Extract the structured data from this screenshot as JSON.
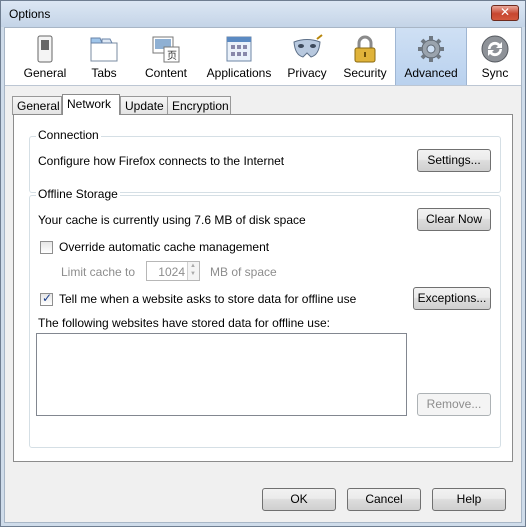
{
  "window": {
    "title": "Options",
    "close_glyph": "✕"
  },
  "panes": [
    {
      "id": "general",
      "label": "General",
      "icon": "switch-icon"
    },
    {
      "id": "tabs",
      "label": "Tabs",
      "icon": "tabs-icon"
    },
    {
      "id": "content",
      "label": "Content",
      "icon": "content-icon"
    },
    {
      "id": "applications",
      "label": "Applications",
      "icon": "applications-icon"
    },
    {
      "id": "privacy",
      "label": "Privacy",
      "icon": "mask-icon"
    },
    {
      "id": "security",
      "label": "Security",
      "icon": "padlock-icon"
    },
    {
      "id": "advanced",
      "label": "Advanced",
      "icon": "gear-icon",
      "selected": true
    },
    {
      "id": "sync",
      "label": "Sync",
      "icon": "sync-icon"
    }
  ],
  "subtabs": [
    {
      "label": "General"
    },
    {
      "label": "Network",
      "selected": true
    },
    {
      "label": "Update"
    },
    {
      "label": "Encryption"
    }
  ],
  "connection": {
    "title": "Connection",
    "description": "Configure how Firefox connects to the Internet",
    "settings_label": "Settings..."
  },
  "offline": {
    "title": "Offline Storage",
    "cache_text": "Your cache is currently using 7.6 MB of disk space",
    "clear_now_label": "Clear Now",
    "override_label": "Override automatic cache management",
    "override_checked": false,
    "limit_label": "Limit cache to",
    "limit_value": "1024",
    "limit_unit": "MB of space",
    "tell_me_label": "Tell me when a website asks to store data for offline use",
    "tell_me_checked": true,
    "exceptions_label": "Exceptions...",
    "stored_label": "The following websites have stored data for offline use:",
    "remove_label": "Remove..."
  },
  "footer": {
    "ok_label": "OK",
    "cancel_label": "Cancel",
    "help_label": "Help"
  },
  "colors": {
    "selected_pane": "#bad1ee",
    "frame": "#cfdcea"
  }
}
